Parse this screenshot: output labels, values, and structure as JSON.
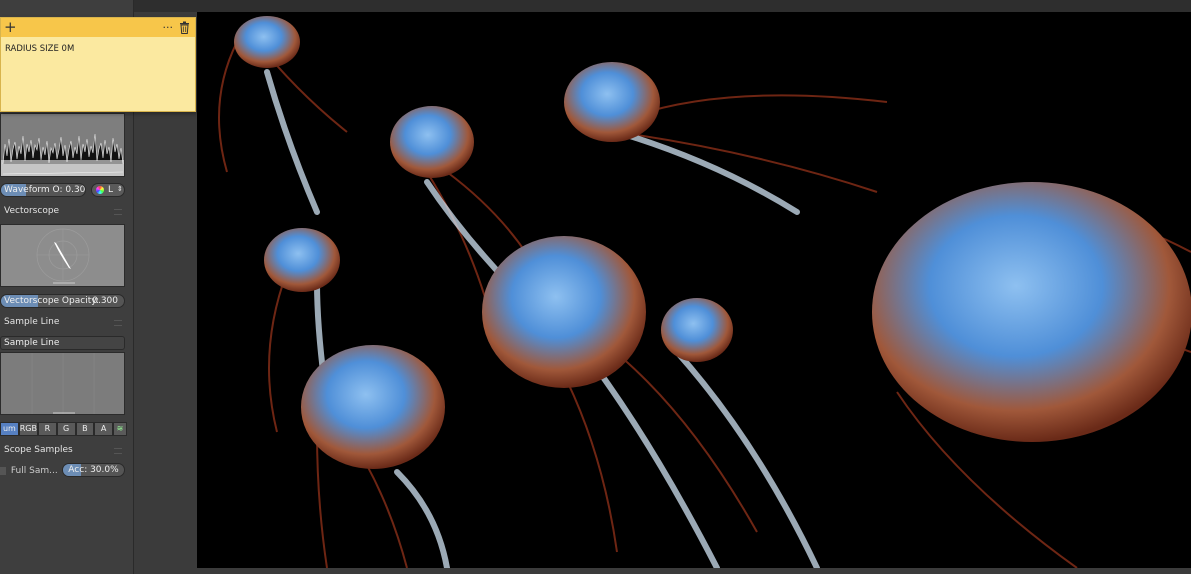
{
  "note": {
    "add_icon": "plus-icon",
    "more_icon": "ellipsis-icon",
    "delete_icon": "trash-icon",
    "text": "RADIUS SIZE 0M"
  },
  "waveform": {
    "opacity_label": "Waveform O: 0.300",
    "opacity_value": 0.3,
    "mode_label": "L"
  },
  "vectorscope": {
    "title": "Vectorscope",
    "opacity_label": "Vectorscope Opacity:",
    "opacity_value": "0.300"
  },
  "sample_line": {
    "title": "Sample Line",
    "button_label": "Sample Line",
    "channels": [
      "um",
      "RGB",
      "R",
      "G",
      "B",
      "A"
    ],
    "active_channel": "um"
  },
  "scope_samples": {
    "title": "Scope Samples",
    "full_samples_label": "Full Sam...",
    "accuracy_label": "Acc: 30.0%",
    "accuracy_value": 30
  },
  "colors": {
    "note_bg": "#fbe9a0",
    "note_bar": "#f7c64a",
    "slider_fill": "#6c8db5",
    "active_button": "#5680c2",
    "jelly_bell": "#4f8fd8",
    "jelly_rim": "#b9542c",
    "tentacle": "#7a2a16"
  }
}
